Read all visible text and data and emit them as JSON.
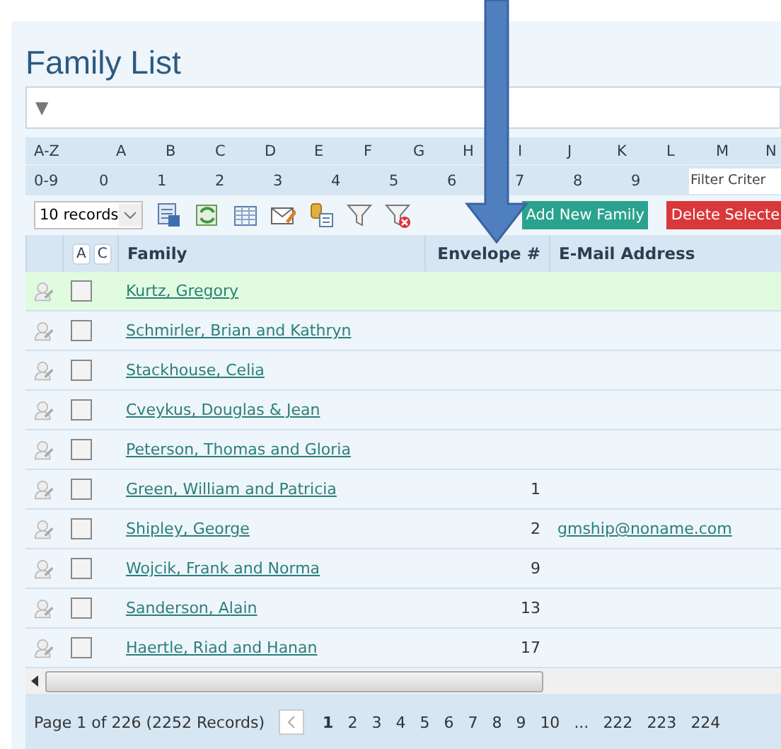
{
  "title": "Family List",
  "filter_toggle": "▼",
  "letters": [
    {
      "label": "A-Z"
    },
    {
      "label": "A"
    },
    {
      "label": "B"
    },
    {
      "label": "C"
    },
    {
      "label": "D"
    },
    {
      "label": "E"
    },
    {
      "label": "F"
    },
    {
      "label": "G"
    },
    {
      "label": "H"
    },
    {
      "label": "I"
    },
    {
      "label": "J"
    },
    {
      "label": "K"
    },
    {
      "label": "L"
    },
    {
      "label": "M"
    },
    {
      "label": "N"
    }
  ],
  "digits": [
    {
      "label": "0-9"
    },
    {
      "label": "0"
    },
    {
      "label": "1"
    },
    {
      "label": "2"
    },
    {
      "label": "3"
    },
    {
      "label": "4"
    },
    {
      "label": "5"
    },
    {
      "label": "6"
    },
    {
      "label": "7"
    },
    {
      "label": "8"
    },
    {
      "label": "9"
    }
  ],
  "filter_field": {
    "placeholder": "Filter Criter"
  },
  "page_size": "10 records",
  "buttons": [
    {
      "label": "Add New Family",
      "kind": "add"
    },
    {
      "label": "Delete Selecte",
      "kind": "delete"
    }
  ],
  "sort_buttons": [
    "A",
    "C"
  ],
  "columns": [
    "Family",
    "Envelope #",
    "E-Mail Address"
  ],
  "rows": [
    {
      "family": "Kurtz, Gregory",
      "envelope": "",
      "email": "",
      "checked": false,
      "selected": true
    },
    {
      "family": "Schmirler, Brian and Kathryn",
      "envelope": "",
      "email": "",
      "checked": false,
      "selected": false
    },
    {
      "family": "Stackhouse, Celia",
      "envelope": "",
      "email": "",
      "checked": false,
      "selected": false
    },
    {
      "family": "Cveykus, Douglas & Jean",
      "envelope": "",
      "email": "",
      "checked": false,
      "selected": false
    },
    {
      "family": "Peterson, Thomas and Gloria",
      "envelope": "",
      "email": "",
      "checked": false,
      "selected": false
    },
    {
      "family": "Green, William and Patricia",
      "envelope": "1",
      "email": "",
      "checked": false,
      "selected": false
    },
    {
      "family": "Shipley, George",
      "envelope": "2",
      "email": "gmship@noname.com",
      "checked": false,
      "selected": false
    },
    {
      "family": "Wojcik, Frank and Norma",
      "envelope": "9",
      "email": "",
      "checked": false,
      "selected": false
    },
    {
      "family": "Sanderson, Alain",
      "envelope": "13",
      "email": "",
      "checked": false,
      "selected": false
    },
    {
      "family": "Haertle, Riad and Hanan",
      "envelope": "17",
      "email": "",
      "checked": false,
      "selected": false
    }
  ],
  "pager": {
    "summary": "Page 1 of 226 (2252 Records)",
    "pages": [
      {
        "label": "1",
        "selected": true
      },
      {
        "label": "2",
        "selected": false
      },
      {
        "label": "3",
        "selected": false
      },
      {
        "label": "4",
        "selected": false
      },
      {
        "label": "5",
        "selected": false
      },
      {
        "label": "6",
        "selected": false
      },
      {
        "label": "7",
        "selected": false
      },
      {
        "label": "8",
        "selected": false
      },
      {
        "label": "9",
        "selected": false
      },
      {
        "label": "10",
        "selected": false
      },
      {
        "label": "...",
        "selected": false
      },
      {
        "label": "222",
        "selected": false
      },
      {
        "label": "223",
        "selected": false
      },
      {
        "label": "224",
        "selected": false
      }
    ]
  }
}
